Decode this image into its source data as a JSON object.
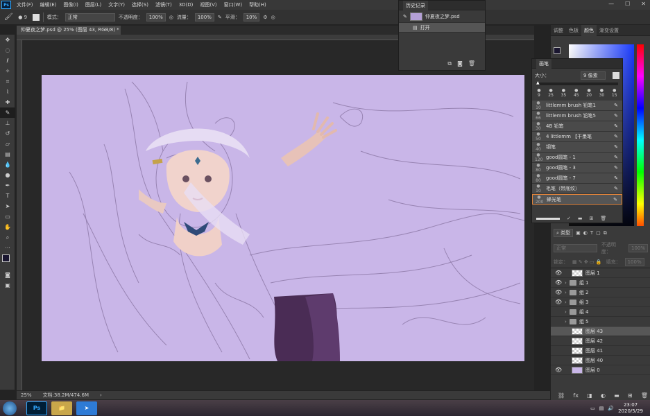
{
  "menubar": {
    "logo": "Ps",
    "items": [
      "文件(F)",
      "编辑(E)",
      "图像(I)",
      "图层(L)",
      "文字(Y)",
      "选择(S)",
      "滤镜(T)",
      "3D(D)",
      "视图(V)",
      "窗口(W)",
      "帮助(H)"
    ],
    "win_minimize": "—",
    "win_maximize": "☐",
    "win_close": "✕"
  },
  "options": {
    "brush_size": "9",
    "mode_label": "模式：",
    "mode_value": "正常",
    "opacity_label": "不透明度：",
    "opacity_value": "100%",
    "flow_label": "流量：",
    "flow_value": "100%",
    "smooth_label": "平滑：",
    "smooth_value": "10%"
  },
  "document": {
    "tab_title": "仲夏夜之梦.psd @ 25% (图层 43, RGB/8) *",
    "tab_close": "×",
    "zoom": "25%",
    "doc_info": "文档:38.2M/474.6M"
  },
  "history": {
    "title": "历史记录",
    "snapshot": "仲夏夜之梦.psd",
    "step": "打开"
  },
  "brush_panel": {
    "title": "画笔",
    "size_label": "大小：",
    "size_value": "9 像素",
    "preset_sizes": [
      "9",
      "25",
      "35",
      "45",
      "20",
      "30",
      "15"
    ],
    "items": [
      {
        "num": "10",
        "name": "littlemm brush 铅笔1"
      },
      {
        "num": "66",
        "name": "littlemm brush 铅笔5"
      },
      {
        "num": "30",
        "name": "4B 铅笔"
      },
      {
        "num": "50",
        "name": "4 littlemm 【干墨笔"
      },
      {
        "num": "40",
        "name": "钢笔"
      },
      {
        "num": "120",
        "name": "good圆笔 - 1"
      },
      {
        "num": "80",
        "name": "good圆笔 - 3"
      },
      {
        "num": "80",
        "name": "good圆笔 - 7"
      },
      {
        "num": "10",
        "name": "毛笔（带底纹）"
      },
      {
        "num": "200",
        "name": "蜂光笔"
      }
    ]
  },
  "right_panel": {
    "tabs": [
      "调整",
      "色板",
      "颜色",
      "渐变设置"
    ],
    "layers_search": "类型",
    "blend_mode": "正常",
    "opacity_label": "不透明度：",
    "opacity_value": "100%",
    "lock_label": "锁定：",
    "fill_label": "填充：",
    "fill_value": "100%",
    "layers": [
      {
        "name": "图层 1",
        "kind": "layer",
        "visible": true
      },
      {
        "name": "组 1",
        "kind": "group",
        "visible": true
      },
      {
        "name": "组 2",
        "kind": "group",
        "visible": true
      },
      {
        "name": "组 3",
        "kind": "group",
        "visible": true
      },
      {
        "name": "组 4",
        "kind": "group",
        "visible": false
      },
      {
        "name": "组 5",
        "kind": "group",
        "visible": false
      },
      {
        "name": "图层 43",
        "kind": "layer",
        "visible": false,
        "selected": true
      },
      {
        "name": "图层 42",
        "kind": "layer",
        "visible": false
      },
      {
        "name": "图层 41",
        "kind": "layer",
        "visible": false
      },
      {
        "name": "图层 40",
        "kind": "layer",
        "visible": false
      },
      {
        "name": "图层 0",
        "kind": "fill",
        "visible": true
      }
    ]
  },
  "taskbar": {
    "clock_time": "23:07",
    "clock_date": "2020/5/29",
    "apps": [
      "Ps",
      "📁",
      "➤"
    ]
  },
  "colors": {
    "canvas_bg": "#c9b6e8",
    "accent": "#31a8ff",
    "selected_brush_border": "#e0833b"
  }
}
